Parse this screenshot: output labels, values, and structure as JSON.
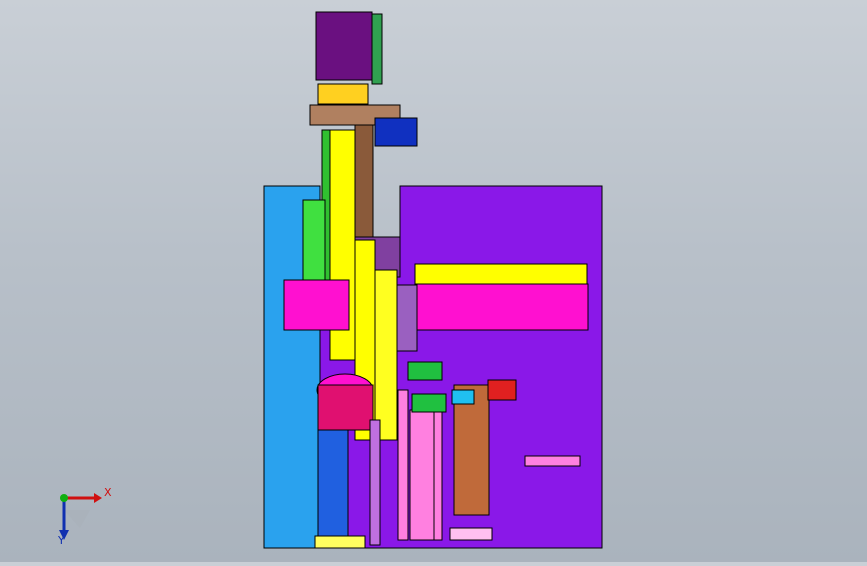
{
  "triad": {
    "x_label": "X",
    "y_label": "Y"
  },
  "colors": {
    "background_top": "#c9cfd6",
    "background_bottom": "#aab3bd",
    "blue_plate": "#2aa2ee",
    "purple_plate": "#8a18e8",
    "yellow": "#ffff00",
    "magenta": "#ff10d0",
    "green": "#20c020",
    "dark_purple": "#6a1080",
    "brown": "#c06a3a",
    "red": "#e02020",
    "navy": "#1030c0",
    "pink": "#ff80e0"
  }
}
